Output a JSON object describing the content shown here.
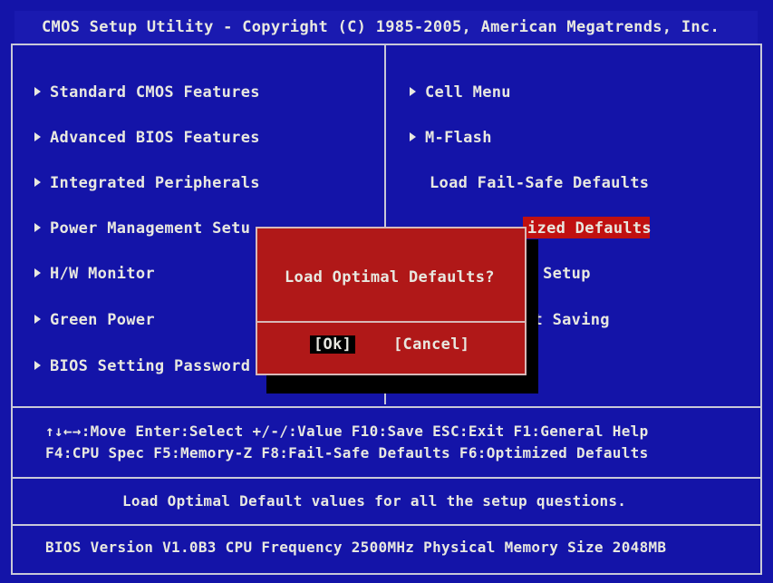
{
  "title": "CMOS Setup Utility - Copyright (C) 1985-2005, American Megatrends, Inc.",
  "left_menu": [
    {
      "label": "Standard CMOS Features",
      "arrow": true
    },
    {
      "label": "Advanced BIOS Features",
      "arrow": true
    },
    {
      "label": "Integrated Peripherals",
      "arrow": true
    },
    {
      "label": "Power Management Setu",
      "arrow": true
    },
    {
      "label": "H/W Monitor",
      "arrow": true
    },
    {
      "label": "Green Power",
      "arrow": true
    },
    {
      "label": "BIOS Setting Password",
      "arrow": true
    }
  ],
  "right_menu": [
    {
      "label": "Cell Menu",
      "arrow": true
    },
    {
      "label": "M-Flash",
      "arrow": true
    },
    {
      "label": "Load Fail-Safe Defaults",
      "arrow": false
    },
    {
      "label": "ized Defaults",
      "arrow": false,
      "selected": true
    },
    {
      "label": "t Setup",
      "arrow": false
    },
    {
      "label": "ut Saving",
      "arrow": false
    }
  ],
  "dialog": {
    "question": "Load Optimal Defaults?",
    "ok_label": "[Ok]",
    "cancel_label": "[Cancel]"
  },
  "help": {
    "line1": "↑↓←→:Move  Enter:Select  +/-/:Value  F10:Save  ESC:Exit  F1:General Help",
    "line2": "F4:CPU Spec  F5:Memory-Z  F8:Fail-Safe Defaults   F6:Optimized Defaults"
  },
  "description": "Load Optimal Default values for all the setup questions.",
  "version_info": "BIOS Version V1.0B3 CPU Frequency 2500MHz Physical Memory Size 2048MB",
  "colors": {
    "background": "#1414a8",
    "text": "#e8e8e0",
    "highlight": "#c01010",
    "dialog": "#b01818"
  }
}
